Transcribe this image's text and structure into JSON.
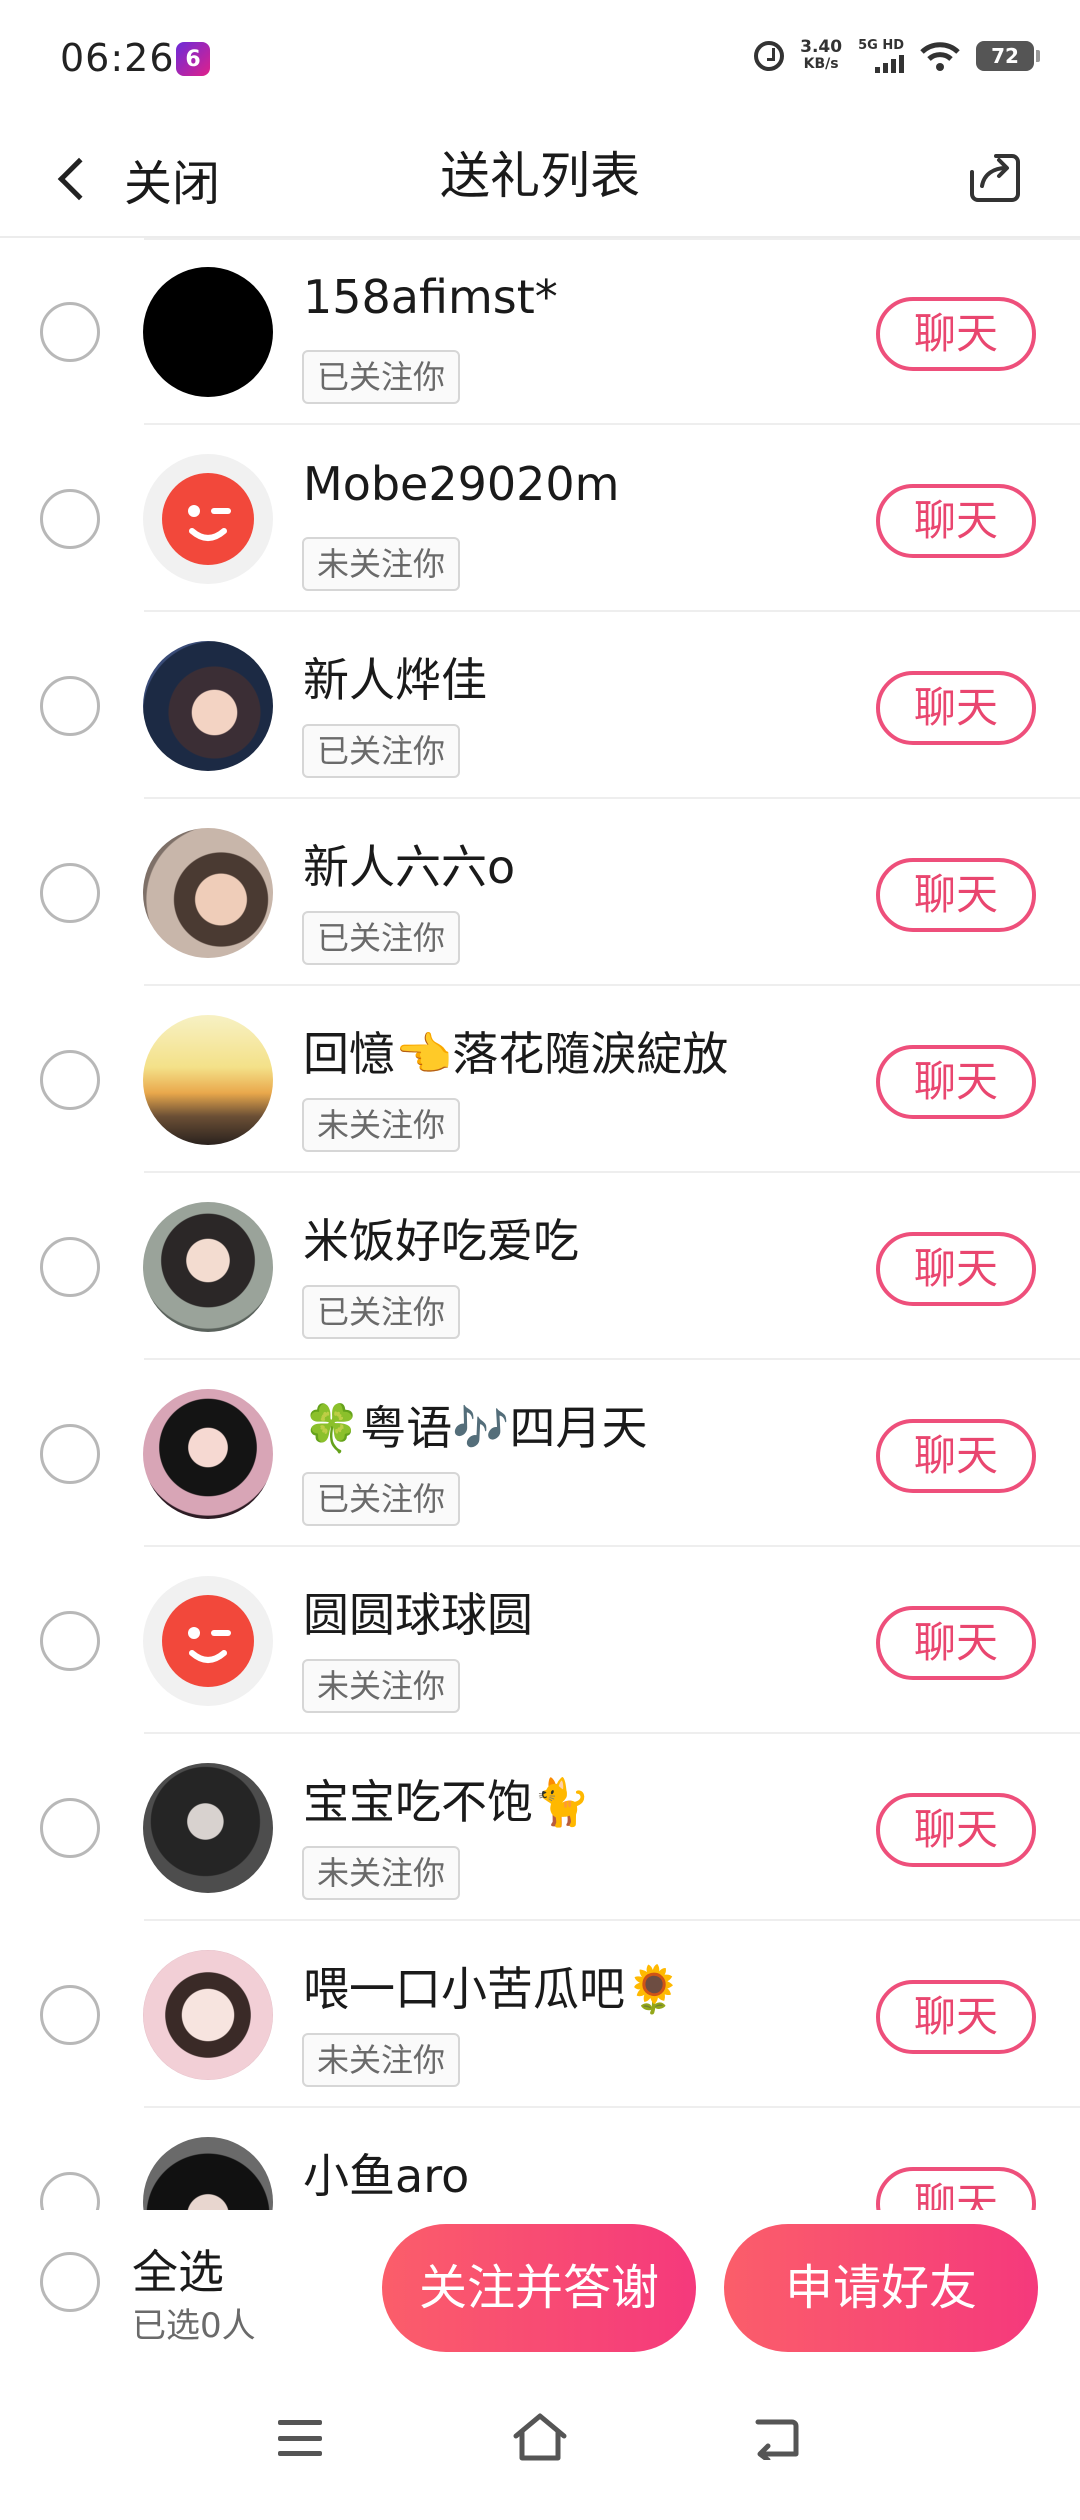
{
  "status_bar": {
    "time": "06:26",
    "app_badge": "6",
    "net_speed_value": "3.40",
    "net_speed_unit": "KB/s",
    "signal_label": "5G HD",
    "battery": "72"
  },
  "header": {
    "back_label": "关闭",
    "title": "送礼列表"
  },
  "rows": [
    {
      "nickname": "158afimst*",
      "follow_status": "已关注你",
      "chat_label": "聊天"
    },
    {
      "nickname": "Mobe29020m",
      "follow_status": "未关注你",
      "chat_label": "聊天"
    },
    {
      "nickname": "新人烨佳",
      "follow_status": "已关注你",
      "chat_label": "聊天"
    },
    {
      "nickname": "新人六六o",
      "follow_status": "已关注你",
      "chat_label": "聊天"
    },
    {
      "nickname": "回憶👈落花隨淚綻放",
      "follow_status": "未关注你",
      "chat_label": "聊天"
    },
    {
      "nickname": "米饭好吃爱吃",
      "follow_status": "已关注你",
      "chat_label": "聊天"
    },
    {
      "nickname": "🍀粤语🎶四月天",
      "follow_status": "已关注你",
      "chat_label": "聊天"
    },
    {
      "nickname": "圆圆球球圆",
      "follow_status": "未关注你",
      "chat_label": "聊天"
    },
    {
      "nickname": "宝宝吃不饱🐈",
      "follow_status": "未关注你",
      "chat_label": "聊天"
    },
    {
      "nickname": "喂一口小苦瓜吧🌻",
      "follow_status": "未关注你",
      "chat_label": "聊天"
    },
    {
      "nickname": "小鱼aro",
      "follow_status": "",
      "chat_label": "聊天"
    }
  ],
  "bottom_bar": {
    "select_all_label": "全选",
    "selected_count": "已选0人",
    "follow_thanks_label": "关注并答谢",
    "add_friend_label": "申请好友"
  },
  "colors": {
    "accent": "#ee4f7b",
    "button_gradient_start": "#fb5e6a",
    "button_gradient_end": "#f5397c"
  }
}
